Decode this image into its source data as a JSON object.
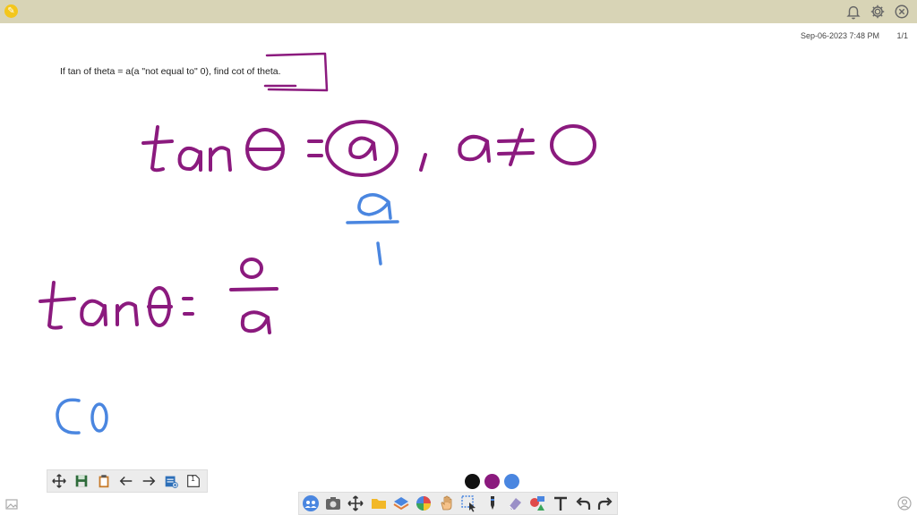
{
  "header": {
    "app_icon": "pencil-logo-icon",
    "right_icons": [
      "bell-icon",
      "gear-icon",
      "close-circle-icon"
    ]
  },
  "board": {
    "timestamp": "Sep-06-2023 7:48 PM",
    "page_indicator": "1/1",
    "question": "If tan of theta = a(a \"not equal to\" 0), find cot of theta."
  },
  "handwriting": {
    "ink_colors": {
      "purple": "#8b1a7e",
      "blue": "#4a86e0"
    }
  },
  "nav_toolbar": {
    "items": [
      "move-icon",
      "save-board-icon",
      "clipboard-icon",
      "arrow-left-icon",
      "arrow-right-icon",
      "add-page-icon",
      "page-number-icon"
    ],
    "page_number": "1"
  },
  "color_palette": {
    "colors": [
      "#111111",
      "#8b1a7e",
      "#4a86e0"
    ]
  },
  "drawing_toolbar": {
    "items": [
      "people-icon",
      "camera-icon",
      "move-icon",
      "folder-icon",
      "layers-icon",
      "color-wheel-icon",
      "hand-icon",
      "select-icon",
      "marker-icon",
      "eraser-icon",
      "shapes-icon",
      "text-icon",
      "undo-icon",
      "redo-icon"
    ]
  }
}
